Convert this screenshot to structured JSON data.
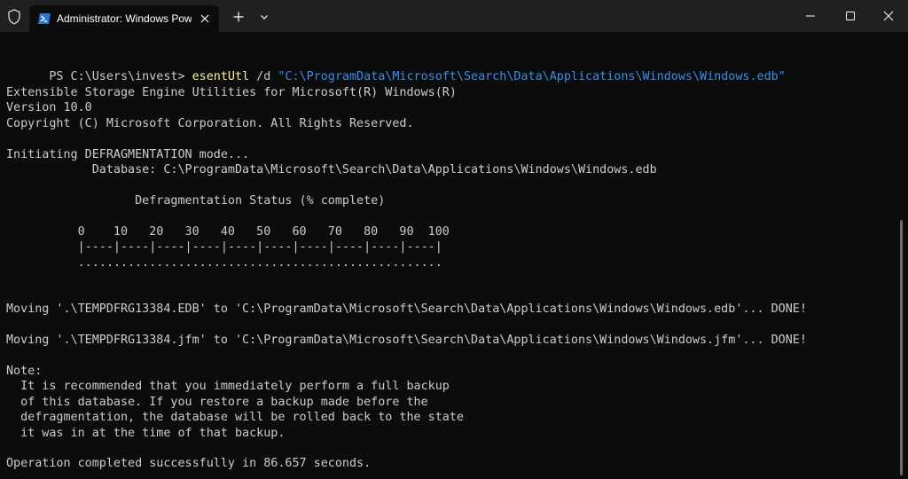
{
  "window": {
    "tab_title": "Administrator: Windows PowerShell",
    "colors": {
      "titlebar": "#202020",
      "background": "#0c0c0c",
      "text": "#cccccc",
      "command": "#f9f1a5",
      "path_string": "#3b8eea"
    },
    "icons": {
      "shield": "shield-icon",
      "powershell": "powershell-icon",
      "close_tab": "close-icon",
      "new_tab": "plus-icon",
      "dropdown": "chevron-down-icon",
      "minimize": "minimize-icon",
      "maximize": "maximize-icon",
      "close": "close-icon"
    }
  },
  "terminal": {
    "prompt": "PS C:\\Users\\invest> ",
    "command_name": "esentUtl",
    "command_switch": " /d ",
    "command_path": "\"C:\\ProgramData\\Microsoft\\Search\\Data\\Applications\\Windows\\Windows.edb\"",
    "lines": [
      "Extensible Storage Engine Utilities for Microsoft(R) Windows(R)",
      "Version 10.0",
      "Copyright (C) Microsoft Corporation. All Rights Reserved.",
      "Initiating DEFRAGMENTATION mode...",
      "            Database: C:\\ProgramData\\Microsoft\\Search\\Data\\Applications\\Windows\\Windows.edb",
      "                  Defragmentation Status (% complete)",
      "          0    10   20   30   40   50   60   70   80   90  100",
      "          |----|----|----|----|----|----|----|----|----|----|",
      "          ...................................................",
      "Moving '.\\TEMPDFRG13384.EDB' to 'C:\\ProgramData\\Microsoft\\Search\\Data\\Applications\\Windows\\Windows.edb'... DONE!",
      "Moving '.\\TEMPDFRG13384.jfm' to 'C:\\ProgramData\\Microsoft\\Search\\Data\\Applications\\Windows\\Windows.jfm'... DONE!",
      "Note:",
      "  It is recommended that you immediately perform a full backup",
      "  of this database. If you restore a backup made before the",
      "  defragmentation, the database will be rolled back to the state",
      "  it was in at the time of that backup.",
      "Operation completed successfully in 86.657 seconds."
    ]
  }
}
